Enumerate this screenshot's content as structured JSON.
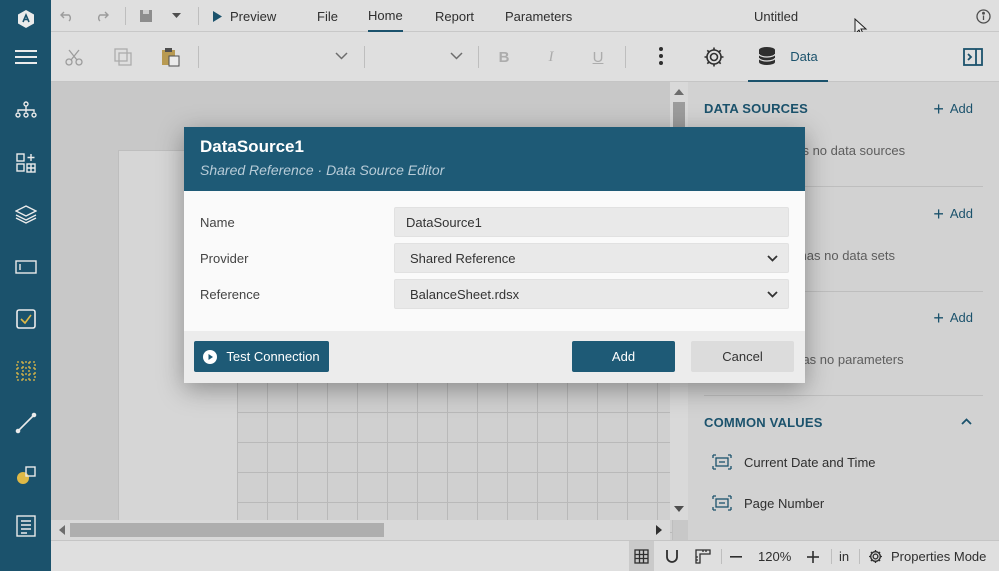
{
  "topbar": {
    "preview": "Preview",
    "menus": [
      "File",
      "Home",
      "Report",
      "Parameters"
    ],
    "active_menu": "Home",
    "doc_title": "Untitled"
  },
  "toolbar": {
    "tab_data": "Data",
    "bold": "B",
    "italic": "I",
    "underline": "U"
  },
  "panel": {
    "data_sources": {
      "title": "DATA SOURCES",
      "add": "Add",
      "empty": "has no data sources"
    },
    "data_sets": {
      "add": "Add",
      "empty": "rt has no data sets"
    },
    "parameters": {
      "add": "Add",
      "empty": "t has no parameters"
    },
    "common_values": {
      "title": "COMMON VALUES",
      "items": [
        "Current Date and Time",
        "Page Number"
      ]
    }
  },
  "status": {
    "zoom": "120%",
    "units": "in",
    "properties_mode": "Properties Mode"
  },
  "dialog": {
    "title": "DataSource1",
    "subtitle": "Shared Reference · Data Source Editor",
    "fields": {
      "name_label": "Name",
      "name_value": "DataSource1",
      "provider_label": "Provider",
      "provider_value": "Shared Reference",
      "reference_label": "Reference",
      "reference_value": "BalanceSheet.rdsx"
    },
    "test_connection": "Test Connection",
    "add": "Add",
    "cancel": "Cancel"
  },
  "colors": {
    "accent": "#1e5a76",
    "panel_bg": "#e4e4e4"
  }
}
